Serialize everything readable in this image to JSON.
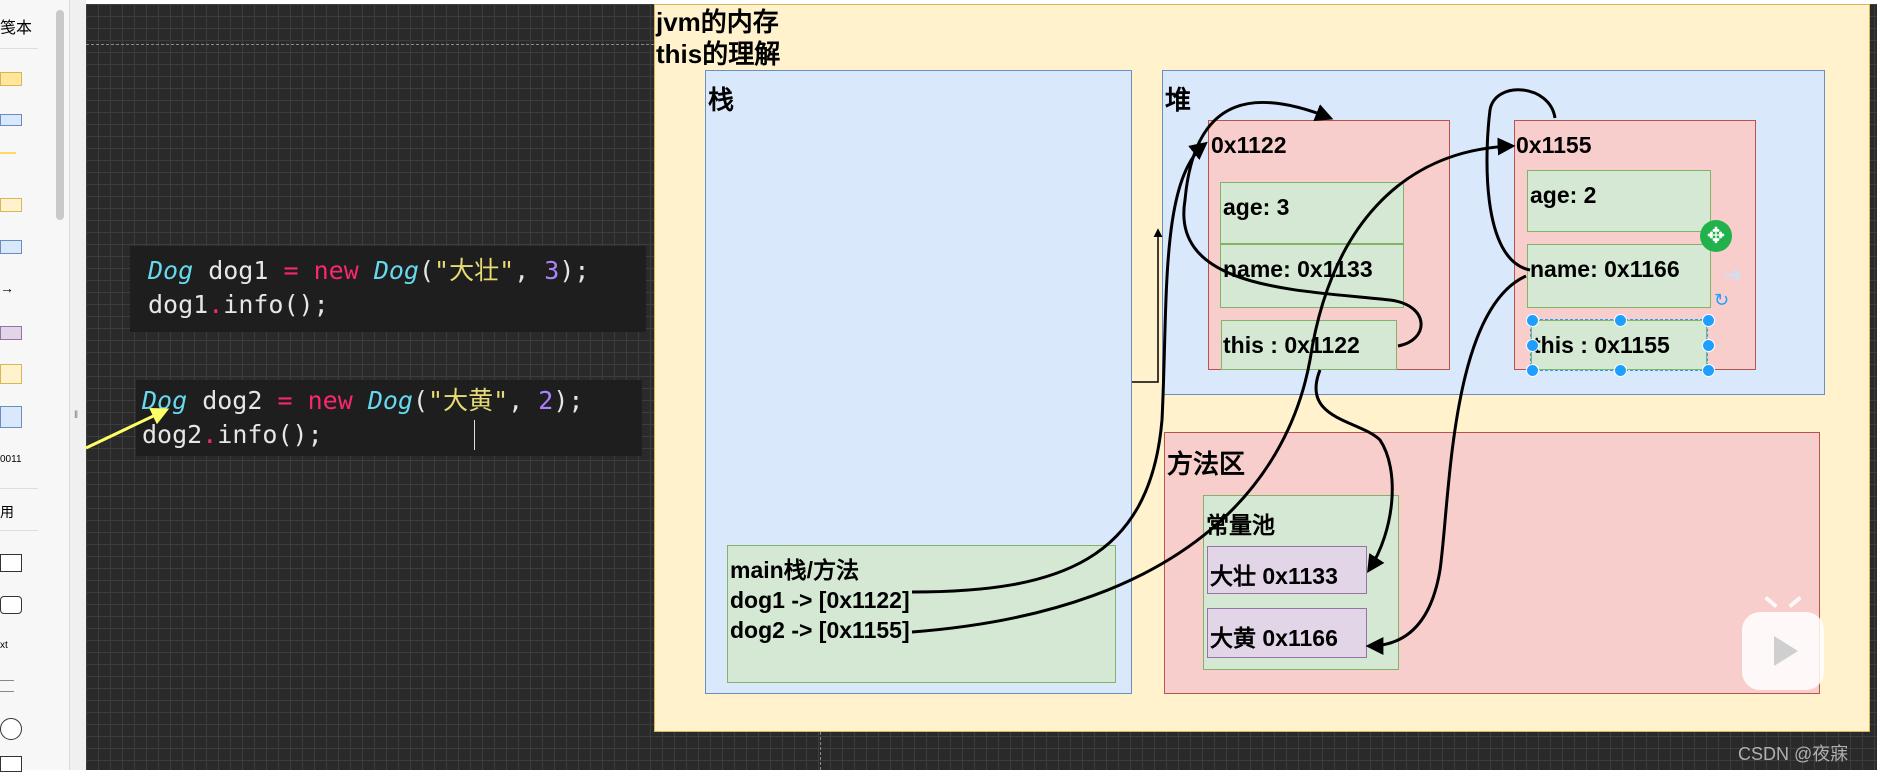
{
  "palette": {
    "partial_label": "笺本",
    "partial_text_1": "0011",
    "partial_text_2": "用",
    "partial_text_3": "xt"
  },
  "code1": {
    "line1": [
      {
        "t": "Dog",
        "c": "kw-type"
      },
      {
        "t": " dog1 ",
        "c": ""
      },
      {
        "t": "=",
        "c": "kw-new"
      },
      {
        "t": " ",
        "c": ""
      },
      {
        "t": "new",
        "c": "kw-new"
      },
      {
        "t": " ",
        "c": ""
      },
      {
        "t": "Dog",
        "c": "kw-type"
      },
      {
        "t": "(",
        "c": ""
      },
      {
        "t": "\"大壮\"",
        "c": "str"
      },
      {
        "t": ", ",
        "c": ""
      },
      {
        "t": "3",
        "c": "num"
      },
      {
        "t": ");",
        "c": ""
      }
    ],
    "line2": [
      {
        "t": "dog1",
        "c": ""
      },
      {
        "t": ".",
        "c": "dot"
      },
      {
        "t": "info();",
        "c": ""
      }
    ]
  },
  "code2": {
    "line1": [
      {
        "t": "Dog",
        "c": "kw-type"
      },
      {
        "t": " dog2 ",
        "c": ""
      },
      {
        "t": "=",
        "c": "kw-new"
      },
      {
        "t": " ",
        "c": ""
      },
      {
        "t": "new",
        "c": "kw-new"
      },
      {
        "t": " ",
        "c": ""
      },
      {
        "t": "Dog",
        "c": "kw-type"
      },
      {
        "t": "(",
        "c": ""
      },
      {
        "t": "\"大黄\"",
        "c": "str"
      },
      {
        "t": ", ",
        "c": ""
      },
      {
        "t": "2",
        "c": "num"
      },
      {
        "t": ");",
        "c": ""
      }
    ],
    "line2": [
      {
        "t": "dog2",
        "c": ""
      },
      {
        "t": ".",
        "c": "dot"
      },
      {
        "t": "info();",
        "c": ""
      }
    ]
  },
  "diagram": {
    "title_line1": "jvm的内存",
    "title_line2": "this的理解",
    "stack": {
      "label": "栈",
      "main_frame": {
        "title": "main栈/方法",
        "dog1": "dog1 -> [0x1122]",
        "dog2": "dog2 -> [0x1155]"
      }
    },
    "heap": {
      "label": "堆",
      "obj1": {
        "addr": "0x1122",
        "age": "age: 3",
        "name": "name: 0x1133",
        "this": "this : 0x1122"
      },
      "obj2": {
        "addr": "0x1155",
        "age": "age: 2",
        "name": "name: 0x1166",
        "this": "this : 0x1155"
      }
    },
    "method_area": {
      "label": "方法区",
      "constant_pool": {
        "label": "常量池",
        "str1": "大壮 0x1133",
        "str2": "大黄 0x1166"
      }
    }
  },
  "watermark": "CSDN @夜寐",
  "colors": {
    "canvas": "#2a2a2a",
    "memory_bg": "#fff2cc",
    "stack_bg": "#dae8fc",
    "heap_obj_bg": "#f8cecc",
    "field_bg": "#d5e8d4",
    "string_bg": "#e1d5e7",
    "selection": "#1e9fff"
  }
}
